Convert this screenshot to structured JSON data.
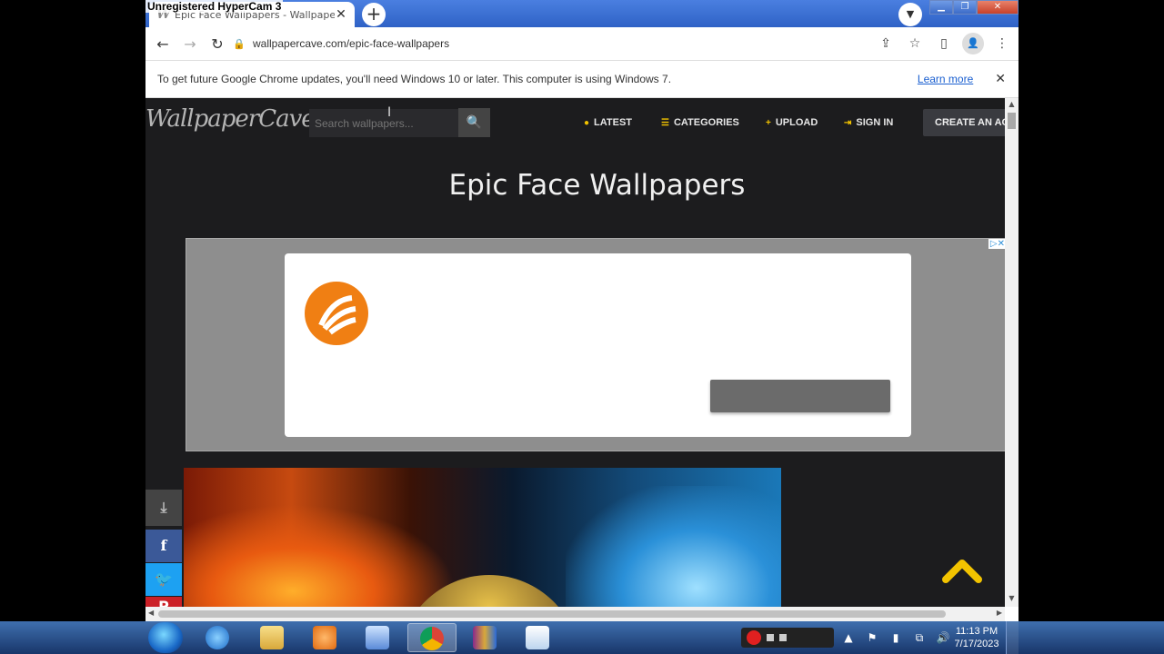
{
  "watermark": "Unregistered HyperCam 3",
  "tab": {
    "title": "Epic Face Wallpapers - Wallpaper",
    "favicon": "W",
    "close": "✕"
  },
  "new_tab": "+",
  "tab_search_icon": "chevron-down-icon",
  "window_controls": {
    "minimize": "▁",
    "maximize": "❐",
    "close": "✕"
  },
  "toolbar": {
    "back": "←",
    "forward": "→",
    "reload": "↻",
    "lock": "🔒",
    "url": "wallpapercave.com/epic-face-wallpapers"
  },
  "toolbar_icons": {
    "share": "⇪",
    "star": "☆",
    "sidepanel": "▯",
    "profile": "👤",
    "menu": "⋮"
  },
  "infobar": {
    "message": "To get future Google Chrome updates, you'll need Windows 10 or later. This computer is using Windows 7.",
    "link": "Learn more",
    "close": "✕"
  },
  "site": {
    "logo": "WallpaperCave",
    "search_placeholder": "Search wallpapers...",
    "search_icon": "🔍",
    "menu": [
      {
        "label": "LATEST",
        "icon": "●"
      },
      {
        "label": "CATEGORIES",
        "icon": "☰"
      },
      {
        "label": "UPLOAD",
        "icon": "+"
      },
      {
        "label": "SIGN IN",
        "icon": "⇥"
      }
    ],
    "create_account": "CREATE AN AC",
    "title": "Epic Face Wallpapers"
  },
  "ad": {
    "choices": "▷✕"
  },
  "share": {
    "download": "⤓",
    "facebook": "f",
    "twitter": "🐦",
    "pinterest": "P"
  },
  "taskbar": {
    "time": "11:13 PM",
    "date": "7/17/2023"
  },
  "colors": {
    "accent_yellow": "#f2c300",
    "site_bg": "#1c1c1e",
    "facebook": "#3b5998",
    "twitter": "#1da1f2",
    "ad_orange": "#f07f13"
  }
}
